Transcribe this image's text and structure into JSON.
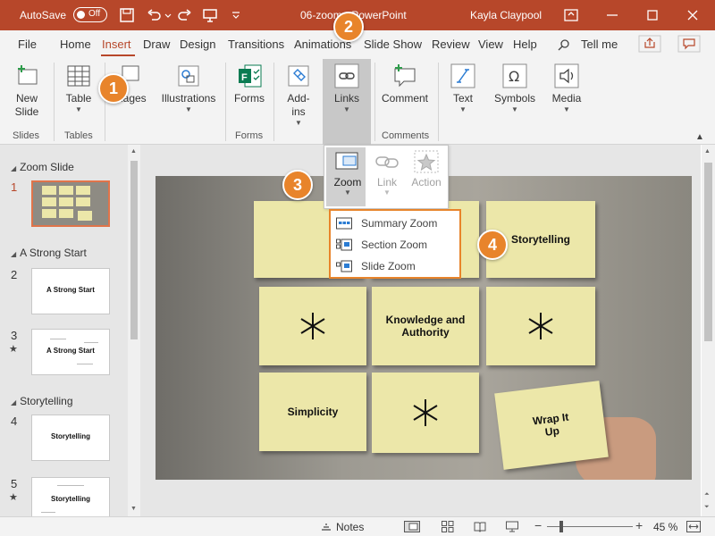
{
  "titlebar": {
    "autosave_label": "AutoSave",
    "autosave_state": "Off",
    "doc_title": "06-zoom - PowerPoint",
    "user_name": "Kayla Claypool",
    "bg_color": "#b7472a"
  },
  "tabs": [
    {
      "label": "File"
    },
    {
      "label": "Home"
    },
    {
      "label": "Insert"
    },
    {
      "label": "Draw"
    },
    {
      "label": "Design"
    },
    {
      "label": "Transitions"
    },
    {
      "label": "Animations"
    },
    {
      "label": "Slide Show"
    },
    {
      "label": "Review"
    },
    {
      "label": "View"
    },
    {
      "label": "Help"
    }
  ],
  "tell_me": "Tell me",
  "ribbon": {
    "new_slide": "New\nSlide",
    "table": "Table",
    "images": "Images",
    "illustrations": "Illustrations",
    "forms": "Forms",
    "addins": "Add-\nins",
    "links": "Links",
    "comment": "Comment",
    "text": "Text",
    "symbols": "Symbols",
    "media": "Media",
    "groups": {
      "slides": "Slides",
      "tables": "Tables",
      "forms": "Forms",
      "comments": "Comments"
    }
  },
  "links_dropdown": {
    "zoom": "Zoom",
    "link": "Link",
    "action": "Action"
  },
  "zoom_menu": [
    {
      "label": "Summary Zoom",
      "icon": "summary-zoom-icon"
    },
    {
      "label": "Section Zoom",
      "icon": "section-zoom-icon"
    },
    {
      "label": "Slide Zoom",
      "icon": "slide-zoom-icon"
    }
  ],
  "callouts": [
    "1",
    "2",
    "3",
    "4"
  ],
  "thumbnails": {
    "sections": [
      "Zoom Slide",
      "A Strong Start",
      "Storytelling"
    ],
    "slides": [
      {
        "num": "1",
        "title": ""
      },
      {
        "num": "2",
        "title": "A Strong Start"
      },
      {
        "num": "3",
        "title": "A Strong Start"
      },
      {
        "num": "4",
        "title": "Storytelling"
      },
      {
        "num": "5",
        "title": "Storytelling"
      }
    ]
  },
  "slide": {
    "notes": [
      {
        "text": ""
      },
      {
        "text": ""
      },
      {
        "text": "Storytelling"
      },
      {
        "text": ""
      },
      {
        "text": "Knowledge and\nAuthority"
      },
      {
        "text": ""
      },
      {
        "text": "Simplicity"
      },
      {
        "text": ""
      },
      {
        "text": "Wrap It\nUp"
      }
    ],
    "note_color": "#ece7a9"
  },
  "statusbar": {
    "notes": "Notes",
    "zoom_level": "45 %"
  },
  "accent_color": "#e8842b"
}
